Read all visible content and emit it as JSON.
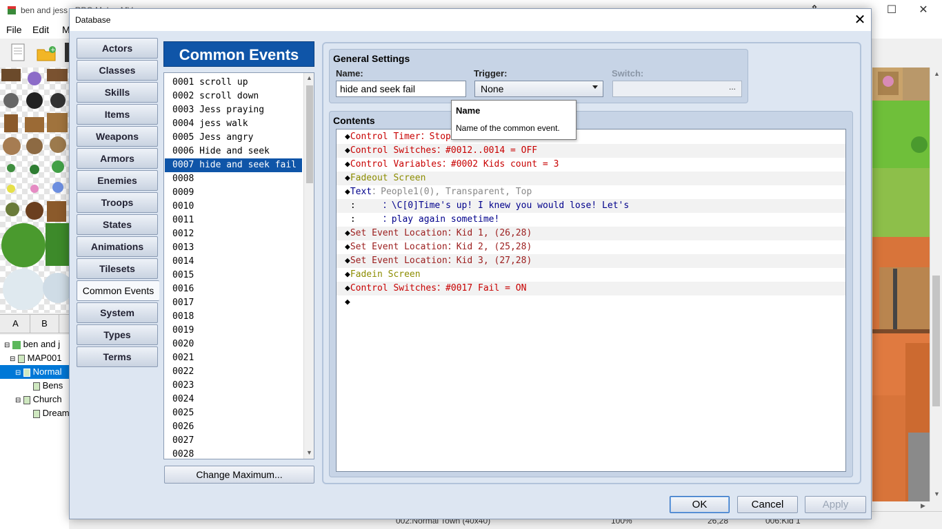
{
  "app": {
    "title": "ben and jess - RPG Maker MV",
    "menu": [
      "File",
      "Edit",
      "M"
    ],
    "window_buttons": [
      "—",
      "☐",
      "✕"
    ],
    "tileset_tabs": [
      "A",
      "B"
    ],
    "map_tree": [
      {
        "label": "ben and j",
        "level": 0,
        "icon": "project-icon"
      },
      {
        "label": "MAP001",
        "level": 1,
        "icon": "map-icon"
      },
      {
        "label": "Normal",
        "level": 2,
        "icon": "map-icon",
        "selected": true
      },
      {
        "label": "Bens",
        "level": 3,
        "icon": "map-icon"
      },
      {
        "label": "Church",
        "level": 2,
        "icon": "map-icon"
      },
      {
        "label": "Dream",
        "level": 3,
        "icon": "map-icon"
      }
    ],
    "status": {
      "map": "002:Normal Town (40x40)",
      "zoom": "100%",
      "coords": "26,28",
      "event": "006:Kid 1"
    }
  },
  "dialog": {
    "title": "Database",
    "nav": [
      "Actors",
      "Classes",
      "Skills",
      "Items",
      "Weapons",
      "Armors",
      "Enemies",
      "Troops",
      "States",
      "Animations",
      "Tilesets",
      "Common Events",
      "System",
      "Types",
      "Terms"
    ],
    "active_nav": "Common Events",
    "list_header": "Common Events",
    "list": [
      "0001 scroll up",
      "0002 scroll down",
      "0003 Jess praying",
      "0004 jess walk",
      "0005 Jess angry",
      "0006 Hide and seek",
      "0007 hide and seek fail",
      "0008",
      "0009",
      "0010",
      "0011",
      "0012",
      "0013",
      "0014",
      "0015",
      "0016",
      "0017",
      "0018",
      "0019",
      "0020",
      "0021",
      "0022",
      "0023",
      "0024",
      "0025",
      "0026",
      "0027",
      "0028"
    ],
    "selected_index": 6,
    "change_max_label": "Change Maximum...",
    "general": {
      "title": "General Settings",
      "name_label": "Name:",
      "name_value": "hide and seek fail",
      "trigger_label": "Trigger:",
      "trigger_value": "None",
      "switch_label": "Switch:",
      "switch_button": "..."
    },
    "contents_title": "Contents",
    "commands": [
      {
        "prefix": "◆",
        "text": "Control Timer：Stop",
        "color": "red"
      },
      {
        "prefix": "◆",
        "text": "Control Switches：#0012..0014 = OFF",
        "color": "red"
      },
      {
        "prefix": "◆",
        "text": "Control Variables：#0002 Kids count = 3",
        "color": "red"
      },
      {
        "prefix": "◆",
        "text": "Fadeout Screen",
        "color": "olive"
      },
      {
        "prefix": "◆",
        "text": "Text",
        "suffix": "：People1(0), Transparent, Top",
        "color": "navy"
      },
      {
        "prefix": " :     ",
        "text": "：\\C[0]Time's up! I knew you would lose! Let's",
        "color": "navy"
      },
      {
        "prefix": " :     ",
        "text": "：play again sometime!",
        "color": "navy"
      },
      {
        "prefix": "◆",
        "text": "Set Event Location：Kid 1, (26,28)",
        "color": "maroon"
      },
      {
        "prefix": "◆",
        "text": "Set Event Location：Kid 2, (25,28)",
        "color": "maroon"
      },
      {
        "prefix": "◆",
        "text": "Set Event Location：Kid 3, (27,28)",
        "color": "maroon"
      },
      {
        "prefix": "◆",
        "text": "Fadein Screen",
        "color": "olive"
      },
      {
        "prefix": "◆",
        "text": "Control Switches：#0017 Fail = ON",
        "color": "red"
      },
      {
        "prefix": "◆",
        "text": "",
        "color": "dark"
      }
    ],
    "tooltip": {
      "title": "Name",
      "text": "Name of the common event."
    },
    "buttons": {
      "ok": "OK",
      "cancel": "Cancel",
      "apply": "Apply"
    },
    "close": "✕"
  },
  "colors": {
    "header_blue": "#0f55a8",
    "dialog_bg": "#dde6f2",
    "group_bg": "#c7d4e6",
    "cmd_red": "#c80000",
    "cmd_olive": "#8c8c00",
    "cmd_navy": "#00008b"
  }
}
